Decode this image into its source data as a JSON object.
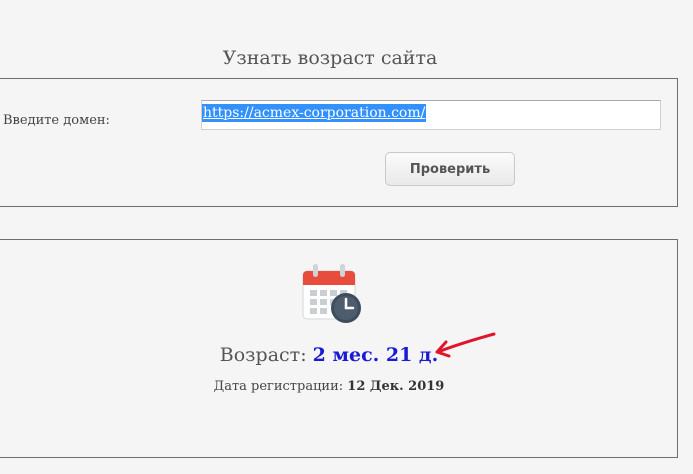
{
  "page": {
    "title": "Узнать возраст сайта"
  },
  "form": {
    "domain_label": "Введите домен:",
    "domain_value": "https://acmex-corporation.com/",
    "check_button": "Проверить"
  },
  "result": {
    "age_label": "Возраст:",
    "age_value": "2 мес. 21 д.",
    "registration_label": "Дата регистрации:",
    "registration_value": "12 Дек. 2019"
  },
  "colors": {
    "accent_blue": "#1a1ad6",
    "selection": "#3391ff",
    "annotation_red": "#e0142a"
  },
  "icons": {
    "calendar": "calendar-clock-icon",
    "annotation": "red-arrow-annotation"
  }
}
